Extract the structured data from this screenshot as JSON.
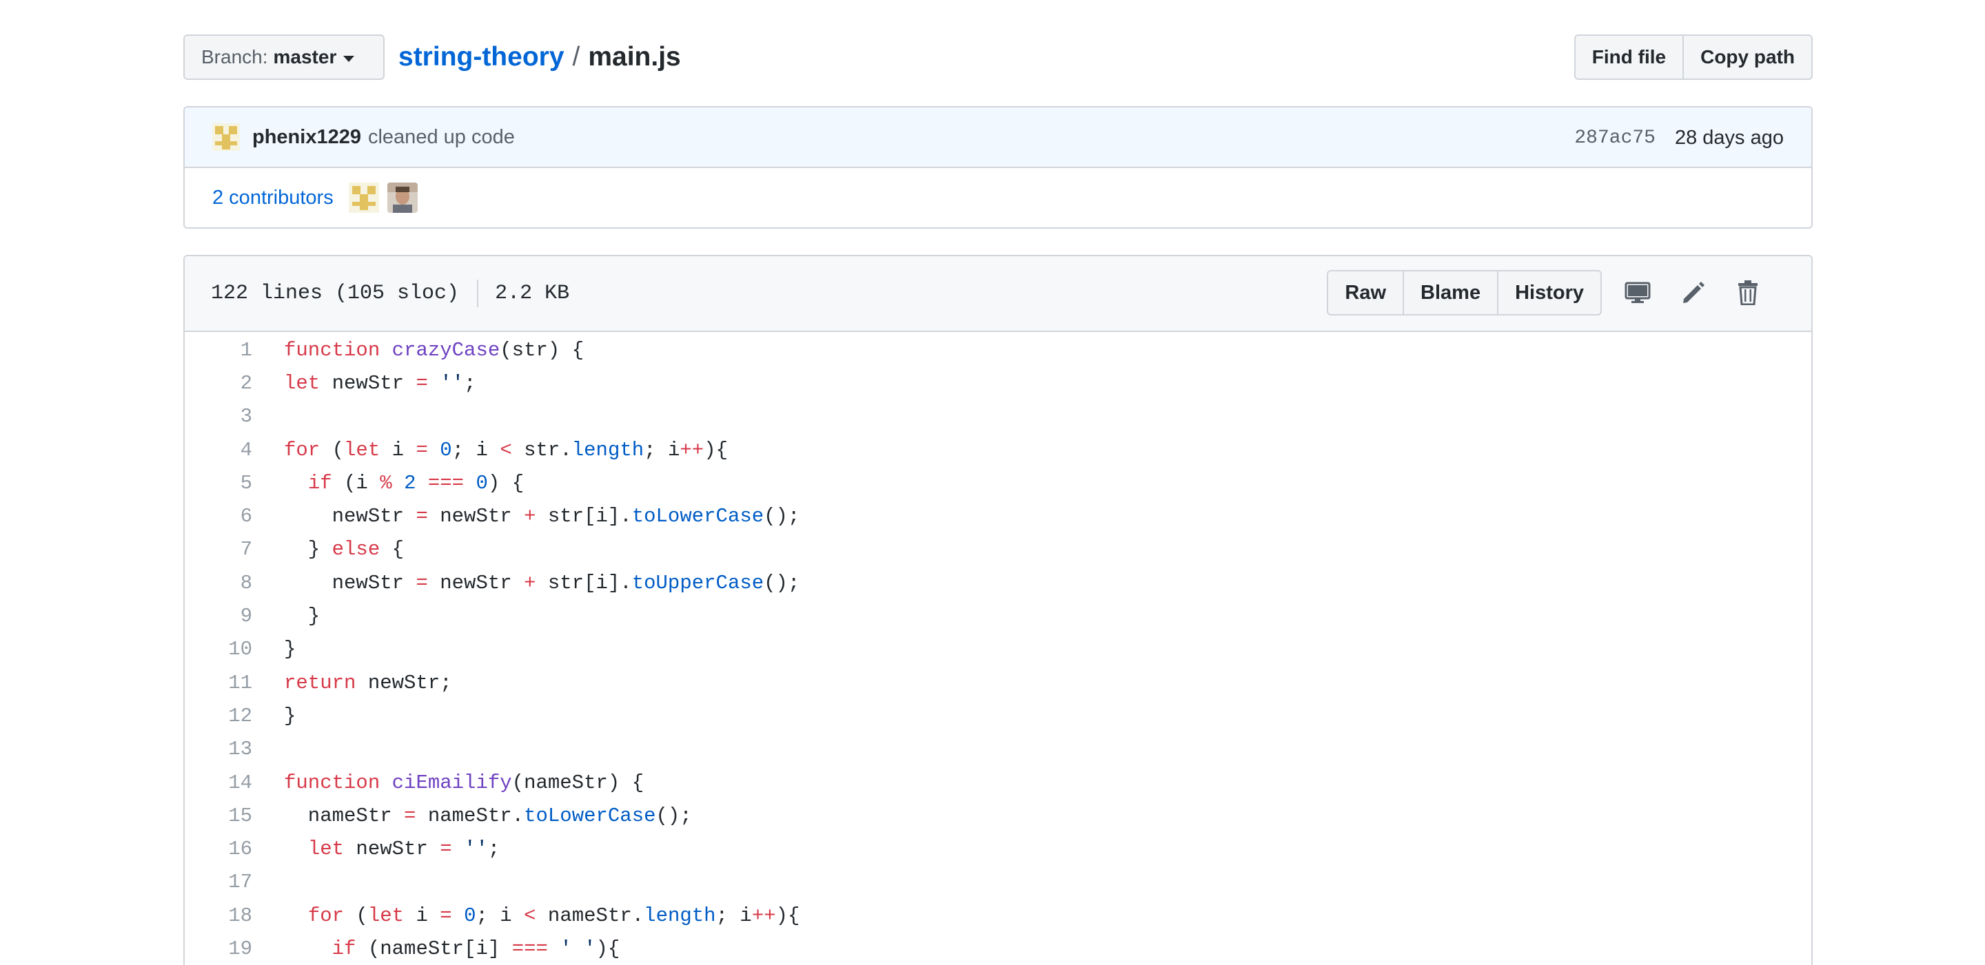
{
  "branch": {
    "label": "Branch:",
    "name": "master"
  },
  "breadcrumb": {
    "repo": "string-theory",
    "separator": "/",
    "file": "main.js"
  },
  "top_actions": {
    "find_file": "Find file",
    "copy_path": "Copy path"
  },
  "commit": {
    "author": "phenix1229",
    "message": "cleaned up code",
    "sha": "287ac75",
    "age": "28 days ago"
  },
  "contributors": {
    "label": "2 contributors"
  },
  "file": {
    "lines_info": "122 lines (105 sloc)",
    "size": "2.2 KB"
  },
  "file_actions": {
    "raw": "Raw",
    "blame": "Blame",
    "history": "History"
  },
  "colors": {
    "link": "#0366d6",
    "keyword": "#d73a49",
    "function": "#6f42c1",
    "constant": "#005cc5",
    "string": "#032f62",
    "line_number": "#959da5"
  },
  "code_lines": [
    {
      "n": "1",
      "tokens": [
        {
          "t": "function",
          "c": "k"
        },
        {
          "t": " "
        },
        {
          "t": "crazyCase",
          "c": "f"
        },
        {
          "t": "(str) {"
        }
      ]
    },
    {
      "n": "2",
      "tokens": [
        {
          "t": "let",
          "c": "k"
        },
        {
          "t": " newStr "
        },
        {
          "t": "=",
          "c": "k"
        },
        {
          "t": " "
        },
        {
          "t": "''",
          "c": "s"
        },
        {
          "t": ";"
        }
      ]
    },
    {
      "n": "3",
      "tokens": []
    },
    {
      "n": "4",
      "tokens": [
        {
          "t": "for",
          "c": "k"
        },
        {
          "t": " ("
        },
        {
          "t": "let",
          "c": "k"
        },
        {
          "t": " i "
        },
        {
          "t": "=",
          "c": "k"
        },
        {
          "t": " "
        },
        {
          "t": "0",
          "c": "c"
        },
        {
          "t": "; i "
        },
        {
          "t": "<",
          "c": "k"
        },
        {
          "t": " str."
        },
        {
          "t": "length",
          "c": "c"
        },
        {
          "t": "; i"
        },
        {
          "t": "++",
          "c": "k"
        },
        {
          "t": "){"
        }
      ]
    },
    {
      "n": "5",
      "tokens": [
        {
          "t": "  "
        },
        {
          "t": "if",
          "c": "k"
        },
        {
          "t": " (i "
        },
        {
          "t": "%",
          "c": "k"
        },
        {
          "t": " "
        },
        {
          "t": "2",
          "c": "c"
        },
        {
          "t": " "
        },
        {
          "t": "===",
          "c": "k"
        },
        {
          "t": " "
        },
        {
          "t": "0",
          "c": "c"
        },
        {
          "t": ") {"
        }
      ]
    },
    {
      "n": "6",
      "tokens": [
        {
          "t": "    newStr "
        },
        {
          "t": "=",
          "c": "k"
        },
        {
          "t": " newStr "
        },
        {
          "t": "+",
          "c": "k"
        },
        {
          "t": " str[i]."
        },
        {
          "t": "toLowerCase",
          "c": "c"
        },
        {
          "t": "();"
        }
      ]
    },
    {
      "n": "7",
      "tokens": [
        {
          "t": "  } "
        },
        {
          "t": "else",
          "c": "k"
        },
        {
          "t": " {"
        }
      ]
    },
    {
      "n": "8",
      "tokens": [
        {
          "t": "    newStr "
        },
        {
          "t": "=",
          "c": "k"
        },
        {
          "t": " newStr "
        },
        {
          "t": "+",
          "c": "k"
        },
        {
          "t": " str[i]."
        },
        {
          "t": "toUpperCase",
          "c": "c"
        },
        {
          "t": "();"
        }
      ]
    },
    {
      "n": "9",
      "tokens": [
        {
          "t": "  }"
        }
      ]
    },
    {
      "n": "10",
      "tokens": [
        {
          "t": "}"
        }
      ]
    },
    {
      "n": "11",
      "tokens": [
        {
          "t": "return",
          "c": "k"
        },
        {
          "t": " newStr;"
        }
      ]
    },
    {
      "n": "12",
      "tokens": [
        {
          "t": "}"
        }
      ]
    },
    {
      "n": "13",
      "tokens": []
    },
    {
      "n": "14",
      "tokens": [
        {
          "t": "function",
          "c": "k"
        },
        {
          "t": " "
        },
        {
          "t": "ciEmailify",
          "c": "f"
        },
        {
          "t": "(nameStr) {"
        }
      ]
    },
    {
      "n": "15",
      "tokens": [
        {
          "t": "  nameStr "
        },
        {
          "t": "=",
          "c": "k"
        },
        {
          "t": " nameStr."
        },
        {
          "t": "toLowerCase",
          "c": "c"
        },
        {
          "t": "();"
        }
      ]
    },
    {
      "n": "16",
      "tokens": [
        {
          "t": "  "
        },
        {
          "t": "let",
          "c": "k"
        },
        {
          "t": " newStr "
        },
        {
          "t": "=",
          "c": "k"
        },
        {
          "t": " "
        },
        {
          "t": "''",
          "c": "s"
        },
        {
          "t": ";"
        }
      ]
    },
    {
      "n": "17",
      "tokens": []
    },
    {
      "n": "18",
      "tokens": [
        {
          "t": "  "
        },
        {
          "t": "for",
          "c": "k"
        },
        {
          "t": " ("
        },
        {
          "t": "let",
          "c": "k"
        },
        {
          "t": " i "
        },
        {
          "t": "=",
          "c": "k"
        },
        {
          "t": " "
        },
        {
          "t": "0",
          "c": "c"
        },
        {
          "t": "; i "
        },
        {
          "t": "<",
          "c": "k"
        },
        {
          "t": " nameStr."
        },
        {
          "t": "length",
          "c": "c"
        },
        {
          "t": "; i"
        },
        {
          "t": "++",
          "c": "k"
        },
        {
          "t": "){"
        }
      ]
    },
    {
      "n": "19",
      "tokens": [
        {
          "t": "    "
        },
        {
          "t": "if",
          "c": "k"
        },
        {
          "t": " (nameStr[i] "
        },
        {
          "t": "===",
          "c": "k"
        },
        {
          "t": " "
        },
        {
          "t": "' '",
          "c": "s"
        },
        {
          "t": "){"
        }
      ]
    }
  ]
}
